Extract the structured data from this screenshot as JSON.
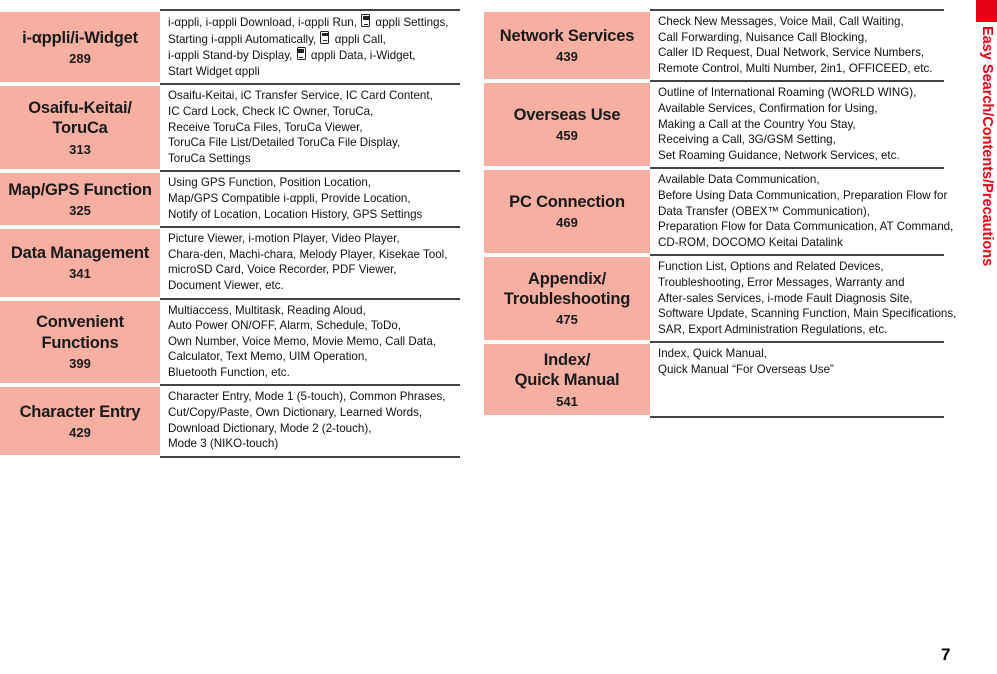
{
  "page": {
    "number": "7",
    "side_tab_label": "Easy Search/Contents/Precautions",
    "accent_color": "#E60012",
    "chapter_cell_color": "#F7AFA2",
    "rule_color": "#444444"
  },
  "left_column": {
    "rows": [
      {
        "title_lines": [
          "i-αppli/i-Widget"
        ],
        "page": "289",
        "description_lines": [
          "i-αppli, i-αppli Download, i-αppli Run, ▫ αppli Settings,",
          "Starting i-αppli Automatically, ▫ αppli Call,",
          "i-αppli Stand-by Display, ▫ αppli Data, i-Widget,",
          "Start Widget αppli"
        ]
      },
      {
        "title_lines": [
          "Osaifu-Keitai/",
          "ToruCa"
        ],
        "page": "313",
        "description_lines": [
          "Osaifu-Keitai, iC Transfer Service, IC Card Content,",
          "IC Card Lock, Check IC Owner, ToruCa,",
          "Receive ToruCa Files, ToruCa Viewer,",
          "ToruCa File List/Detailed ToruCa File Display,",
          "ToruCa Settings"
        ]
      },
      {
        "title_lines": [
          "Map/GPS Function"
        ],
        "page": "325",
        "description_lines": [
          "Using GPS Function, Position Location,",
          "Map/GPS Compatible i-αppli, Provide Location,",
          "Notify of Location, Location History, GPS Settings"
        ]
      },
      {
        "title_lines": [
          "Data Management"
        ],
        "page": "341",
        "description_lines": [
          "Picture Viewer, i-motion Player, Video Player,",
          "Chara-den, Machi-chara, Melody Player, Kisekae Tool,",
          "microSD Card, Voice Recorder, PDF Viewer,",
          "Document Viewer, etc."
        ]
      },
      {
        "title_lines": [
          "Convenient",
          "Functions"
        ],
        "page": "399",
        "description_lines": [
          "Multiaccess, Multitask, Reading Aloud,",
          "Auto Power ON/OFF, Alarm, Schedule, ToDo,",
          "Own Number, Voice Memo, Movie Memo, Call Data,",
          "Calculator, Text Memo, UIM Operation,",
          "Bluetooth Function, etc."
        ]
      },
      {
        "title_lines": [
          "Character Entry"
        ],
        "page": "429",
        "description_lines": [
          "Character Entry, Mode 1 (5-touch), Common Phrases,",
          "Cut/Copy/Paste, Own Dictionary, Learned Words,",
          "Download Dictionary, Mode 2 (2-touch),",
          "Mode 3 (NIKO-touch)"
        ]
      }
    ]
  },
  "right_column": {
    "rows": [
      {
        "title_lines": [
          "Network Services"
        ],
        "page": "439",
        "description_lines": [
          "Check New Messages, Voice Mail, Call Waiting,",
          "Call Forwarding, Nuisance Call Blocking,",
          "Caller ID Request, Dual Network, Service Numbers,",
          "Remote Control, Multi Number, 2in1, OFFICEED, etc."
        ]
      },
      {
        "title_lines": [
          "Overseas Use"
        ],
        "page": "459",
        "description_lines": [
          "Outline of International Roaming (WORLD WING),",
          "Available Services, Confirmation for Using,",
          "Making a Call at the Country You Stay,",
          "Receiving a Call, 3G/GSM Setting,",
          "Set Roaming Guidance, Network Services, etc."
        ]
      },
      {
        "title_lines": [
          "PC Connection"
        ],
        "page": "469",
        "description_lines": [
          "Available Data Communication,",
          "Before Using Data Communication, Preparation Flow for",
          "Data Transfer (OBEX™ Communication),",
          "Preparation Flow for Data Communication, AT Command,",
          "CD-ROM, DOCOMO Keitai Datalink"
        ]
      },
      {
        "title_lines": [
          "Appendix/",
          "Troubleshooting"
        ],
        "page": "475",
        "description_lines": [
          "Function List, Options and Related Devices,",
          "Troubleshooting, Error Messages, Warranty and",
          "After-sales Services, i-mode Fault Diagnosis Site,",
          "Software Update, Scanning Function, Main Specifications,",
          "SAR, Export Administration Regulations, etc."
        ]
      },
      {
        "title_lines": [
          "Index/",
          "Quick Manual"
        ],
        "page": "541",
        "description_lines": [
          "Index, Quick Manual,",
          "Quick Manual “For Overseas Use”"
        ]
      }
    ]
  }
}
